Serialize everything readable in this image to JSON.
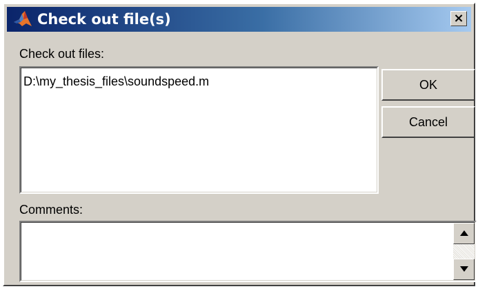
{
  "window": {
    "title": "Check out file(s)",
    "icon": "matlab-logo-icon",
    "close_label": "×"
  },
  "files_section": {
    "label": "Check out files:",
    "items": [
      "D:\\my_thesis_files\\soundspeed.m"
    ]
  },
  "comments_section": {
    "label": "Comments:",
    "value": ""
  },
  "buttons": {
    "ok_label": "OK",
    "cancel_label": "Cancel"
  },
  "colors": {
    "titlebar_start": "#0a246a",
    "titlebar_end": "#a6caf0",
    "face": "#d4d0c8"
  }
}
